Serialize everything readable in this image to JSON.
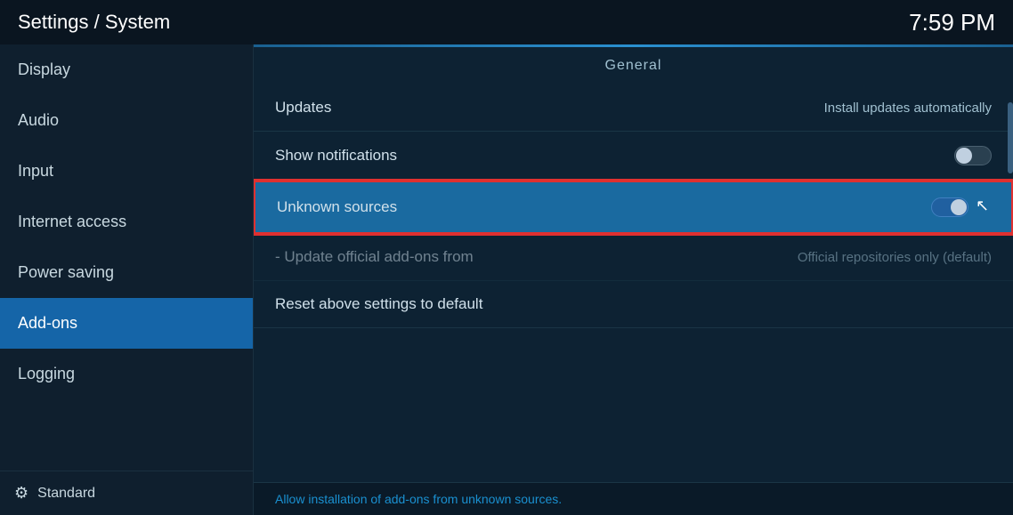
{
  "header": {
    "title": "Settings / System",
    "time": "7:59 PM"
  },
  "sidebar": {
    "items": [
      {
        "id": "display",
        "label": "Display",
        "active": false
      },
      {
        "id": "audio",
        "label": "Audio",
        "active": false
      },
      {
        "id": "input",
        "label": "Input",
        "active": false
      },
      {
        "id": "internet-access",
        "label": "Internet access",
        "active": false
      },
      {
        "id": "power-saving",
        "label": "Power saving",
        "active": false
      },
      {
        "id": "add-ons",
        "label": "Add-ons",
        "active": true
      },
      {
        "id": "logging",
        "label": "Logging",
        "active": false
      }
    ],
    "footer_label": "Standard"
  },
  "content": {
    "section_label": "General",
    "rows": [
      {
        "id": "updates",
        "label": "Updates",
        "value": "Install updates automatically",
        "type": "value",
        "highlighted": false,
        "dimmed": false
      },
      {
        "id": "show-notifications",
        "label": "Show notifications",
        "value": "",
        "type": "toggle",
        "toggle_state": "off",
        "highlighted": false,
        "dimmed": false
      },
      {
        "id": "unknown-sources",
        "label": "Unknown sources",
        "value": "",
        "type": "toggle",
        "toggle_state": "on",
        "highlighted": true,
        "dimmed": false
      },
      {
        "id": "update-add-ons",
        "label": "- Update official add-ons from",
        "value": "Official repositories only (default)",
        "type": "value",
        "highlighted": false,
        "dimmed": true
      },
      {
        "id": "reset-settings",
        "label": "Reset above settings to default",
        "value": "",
        "type": "action",
        "highlighted": false,
        "dimmed": false
      }
    ],
    "footer_text": "Allow installation of add-ons from unknown sources."
  }
}
